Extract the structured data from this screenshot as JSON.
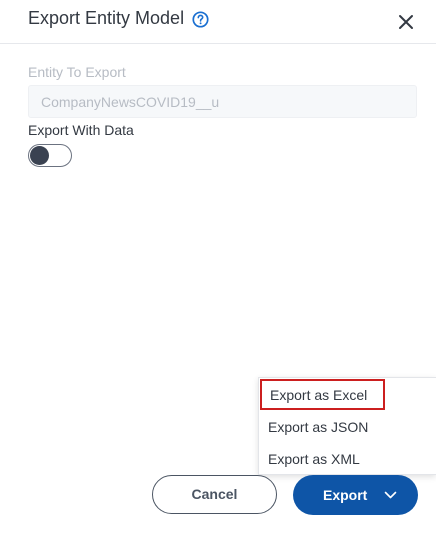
{
  "dialog": {
    "title": "Export Entity Model",
    "help_icon": "help-circle-icon",
    "close_icon": "close-icon"
  },
  "entity": {
    "label": "Entity To Export",
    "value": "CompanyNewsCOVID19__u"
  },
  "export_with_data": {
    "label": "Export With Data",
    "enabled": false
  },
  "export_menu": {
    "items": [
      {
        "label": "Export as Excel",
        "highlighted": true
      },
      {
        "label": "Export as JSON"
      },
      {
        "label": "Export as XML"
      }
    ]
  },
  "buttons": {
    "cancel": "Cancel",
    "export": "Export",
    "export_icon": "chevron-down-icon"
  },
  "colors": {
    "primary": "#0e55a7",
    "highlight_border": "#cc1f1f",
    "help_icon": "#1a6fd1"
  }
}
